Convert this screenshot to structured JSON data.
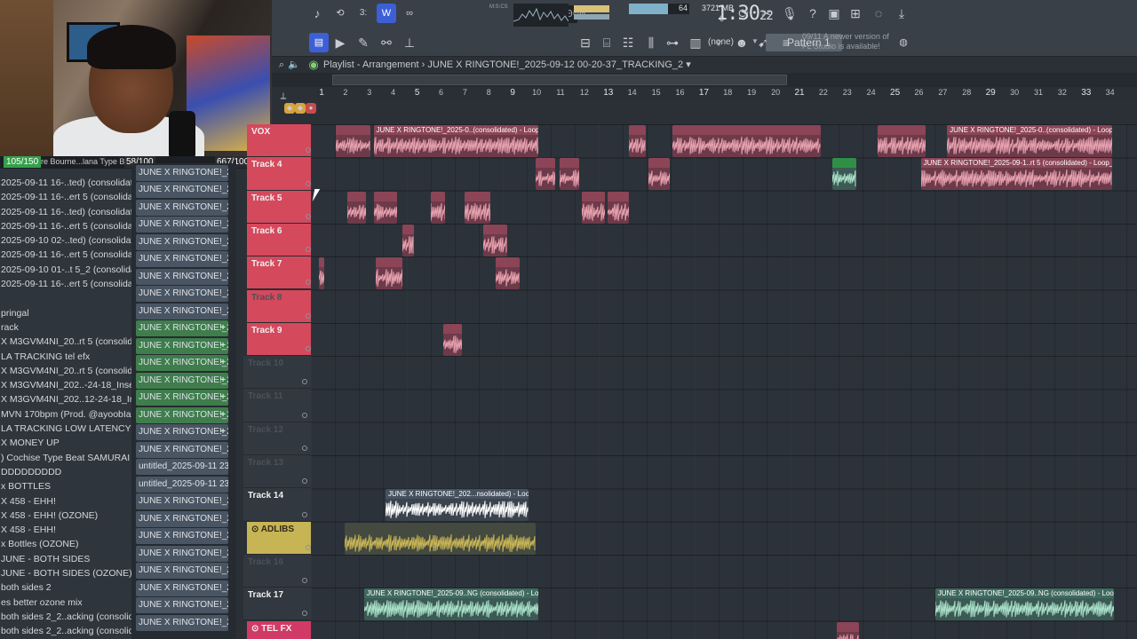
{
  "webcam": {
    "live_badge": "105/150",
    "viewer_count": "58/100",
    "stream_stat": "667/1000",
    "overlay_text": "Pierre Bourne...lana Type Beat Prod"
  },
  "browser": {
    "items": [
      "2025-09-11 16-..ted) (consolidated)",
      "2025-09-11 16-..ert 5 (consolidated)",
      "2025-09-11 16-..ted) (consolidated)",
      "2025-09-11 16-..ert 5 (consolidated)",
      "2025-09-10 02-..ted) (consolidated)",
      "2025-09-11 16-..ert 5 (consolidated)",
      "2025-09-10 01-..t 5_2 (consolidated)",
      "2025-09-11 16-..ert 5 (consolidated)",
      "",
      "pringal",
      "rack",
      "X M3GVM4NI_20..rt 5 (consolidated)",
      "LA TRACKING tel efx",
      "X M3GVM4NI_20..rt 5 (consolidated)",
      "X M3GVM4NI_202..-24-18_Insert 5_2",
      "X M3GVM4NI_202..12-24-18_Insert 5",
      "MVN 170bpm (Prod. @ayoobIanco_)",
      "LA TRACKING LOW LATENCY",
      "X MONEY UP",
      ") Cochise Type Beat SAMURAI",
      "DDDDDDDDD",
      "x BOTTLES",
      "X 458 - EHH!",
      "X 458 - EHH! (OZONE)",
      "X 458 - EHH!",
      "x Bottles (OZONE)",
      "JUNE - BOTH SIDES",
      "JUNE - BOTH SIDES (OZONE)",
      "both sides 2",
      "es better ozone mix",
      "both sides 2_2..acking (consolidated)",
      "both sides 2_2..acking (consolidated)"
    ]
  },
  "picker": {
    "items": [
      {
        "label": "JUNE X RINGTONE!_2025-...",
        "style": "gray"
      },
      {
        "label": "JUNE X RINGTONE!_2025-...",
        "style": "gray"
      },
      {
        "label": "JUNE X RINGTONE!_2025-...",
        "style": "gray"
      },
      {
        "label": "JUNE X RINGTONE!_2025-...",
        "style": "gray"
      },
      {
        "label": "JUNE X RINGTONE!_2025-...",
        "style": "gray"
      },
      {
        "label": "JUNE X RINGTONE!_2025-...",
        "style": "gray"
      },
      {
        "label": "JUNE X RINGTONE!_2025-...",
        "style": "gray"
      },
      {
        "label": "JUNE X RINGTONE!_2025-...",
        "style": "gray"
      },
      {
        "label": "JUNE X RINGTONE!_2025-...",
        "style": "gray"
      },
      {
        "label": "JUNE X RINGTONE!_2...",
        "style": "green"
      },
      {
        "label": "JUNE X RINGTONE!_2...",
        "style": "green"
      },
      {
        "label": "JUNE X RINGTONE!_2...",
        "style": "green"
      },
      {
        "label": "JUNE X RINGTONE!_2...",
        "style": "green"
      },
      {
        "label": "JUNE X RINGTONE!_2...",
        "style": "green"
      },
      {
        "label": "JUNE X RINGTONE!_2...",
        "style": "green"
      },
      {
        "label": "JUNE X RINGTONE!_2...",
        "style": "gray-plus"
      },
      {
        "label": "JUNE X RINGTONE!_2025-...",
        "style": "gray"
      },
      {
        "label": "untitled_2025-09-11 23-...",
        "style": "gray"
      },
      {
        "label": "untitled_2025-09-11 23-...",
        "style": "gray"
      },
      {
        "label": "JUNE X RINGTONE!_2025-...",
        "style": "gray"
      },
      {
        "label": "JUNE X RINGTONE!_2025-...",
        "style": "gray"
      },
      {
        "label": "JUNE X RINGTONE!_2025-...",
        "style": "gray"
      },
      {
        "label": "JUNE X RINGTONE!_2025-...",
        "style": "gray"
      },
      {
        "label": "JUNE X RINGTONE!_2025-...",
        "style": "gray"
      },
      {
        "label": "JUNE X RINGTONE!_2025-...",
        "style": "gray"
      },
      {
        "label": "JUNE X RINGTONE!_2025-...",
        "style": "gray"
      },
      {
        "label": "JUNE X RINGTONE!_2025-...",
        "style": "gray"
      }
    ]
  },
  "toolbar": {
    "tempo": "97.000",
    "time": "1:30",
    "time_frac": "22",
    "time_unit": "M:S:CS",
    "cpu": "64",
    "cpu_fraction": 0.64,
    "memory": "3721 MB",
    "memory_sub": "0",
    "snap": "(none)",
    "pattern": "Pattern 1",
    "news_date": "09/11",
    "news_text": "A newer version of FL Studio is available!"
  },
  "playlist": {
    "title": "Playlist - Arrangement",
    "arrangement": "JUNE X RINGTONE!_2025-09-12 00-20-37_TRACKING_2",
    "bar_numbers": [
      "1",
      "2",
      "3",
      "4",
      "5",
      "6",
      "7",
      "8",
      "9",
      "10",
      "11",
      "12",
      "13",
      "14",
      "15",
      "16",
      "17",
      "18",
      "19",
      "20",
      "21",
      "22",
      "23",
      "24",
      "25",
      "26",
      "27",
      "28",
      "29",
      "30",
      "31",
      "32",
      "33",
      "34"
    ],
    "tracks": [
      {
        "name": "VOX",
        "style": "red"
      },
      {
        "name": "Track 4",
        "style": "red"
      },
      {
        "name": "Track 5",
        "style": "red"
      },
      {
        "name": "Track 6",
        "style": "red"
      },
      {
        "name": "Track 7",
        "style": "red"
      },
      {
        "name": "Track 8",
        "style": "red-dim"
      },
      {
        "name": "Track 9",
        "style": "red"
      },
      {
        "name": "Track 10",
        "style": "dim"
      },
      {
        "name": "Track 11",
        "style": "dim"
      },
      {
        "name": "Track 12",
        "style": "dim"
      },
      {
        "name": "Track 13",
        "style": "dim"
      },
      {
        "name": "Track 14",
        "style": "plain"
      },
      {
        "name": "ADLIBS",
        "style": "yellow"
      },
      {
        "name": "Track 16",
        "style": "dim"
      },
      {
        "name": "Track 17",
        "style": "plain"
      },
      {
        "name": "TEL FX",
        "style": "pink"
      }
    ],
    "clips": [
      {
        "track": 0,
        "bar": 1.8,
        "len": 0.9,
        "label": "",
        "style": "red"
      },
      {
        "track": 0,
        "bar": 2.35,
        "len": 0.9,
        "label": "",
        "style": "red"
      },
      {
        "track": 0,
        "bar": 3.4,
        "len": 6.9,
        "label": "JUNE X RINGTONE!_2025-0..(consolidated) - Loop_2",
        "style": "red"
      },
      {
        "track": 0,
        "bar": 14.1,
        "len": 0.7,
        "label": "",
        "style": "red"
      },
      {
        "track": 0,
        "bar": 15.9,
        "len": 6.2,
        "label": "",
        "style": "red"
      },
      {
        "track": 0,
        "bar": 24.5,
        "len": 2.0,
        "label": "",
        "style": "red"
      },
      {
        "track": 0,
        "bar": 27.4,
        "len": 6.9,
        "label": "JUNE X RINGTONE!_2025-0..(consolidated) - Loop_2",
        "style": "red"
      },
      {
        "track": 1,
        "bar": 10.2,
        "len": 0.8,
        "label": "",
        "style": "red"
      },
      {
        "track": 1,
        "bar": 11.2,
        "len": 0.8,
        "label": "",
        "style": "red"
      },
      {
        "track": 1,
        "bar": 14.9,
        "len": 0.9,
        "label": "",
        "style": "red"
      },
      {
        "track": 1,
        "bar": 22.6,
        "len": 1.0,
        "label": "",
        "style": "green solid"
      },
      {
        "track": 1,
        "bar": 26.3,
        "len": 8.0,
        "label": "JUNE X RINGTONE!_2025-09-1..rt 5 (consolidated) - Loop_3",
        "style": "red"
      },
      {
        "track": 2,
        "bar": 2.3,
        "len": 0.8,
        "label": "",
        "style": "red"
      },
      {
        "track": 2,
        "bar": 3.4,
        "len": 1.0,
        "label": "",
        "style": "red"
      },
      {
        "track": 2,
        "bar": 5.8,
        "len": 0.6,
        "label": "",
        "style": "red"
      },
      {
        "track": 2,
        "bar": 7.2,
        "len": 1.1,
        "label": "",
        "style": "red"
      },
      {
        "track": 2,
        "bar": 12.1,
        "len": 1.0,
        "label": "",
        "style": "red"
      },
      {
        "track": 2,
        "bar": 13.2,
        "len": 0.9,
        "label": "",
        "style": "red"
      },
      {
        "track": 3,
        "bar": 4.6,
        "len": 0.5,
        "label": "",
        "style": "red"
      },
      {
        "track": 3,
        "bar": 8.0,
        "len": 1.0,
        "label": "",
        "style": "red"
      },
      {
        "track": 4,
        "bar": 1.1,
        "len": 0.2,
        "label": "",
        "style": "red"
      },
      {
        "track": 4,
        "bar": 3.5,
        "len": 1.1,
        "label": "",
        "style": "red"
      },
      {
        "track": 4,
        "bar": 8.5,
        "len": 1.0,
        "label": "",
        "style": "red"
      },
      {
        "track": 6,
        "bar": 6.3,
        "len": 0.8,
        "label": "",
        "style": "red"
      },
      {
        "track": 11,
        "bar": 3.9,
        "len": 6.0,
        "label": "JUNE X RINGTONE!_202...nsolidated) - Loop_2",
        "style": "gray"
      },
      {
        "track": 12,
        "bar": 2.2,
        "len": 8.0,
        "label": "",
        "style": "olive"
      },
      {
        "track": 14,
        "bar": 3.0,
        "len": 7.3,
        "label": "JUNE X RINGTONE!_2025-09..NG (consolidated) - Loop_3",
        "style": "green"
      },
      {
        "track": 14,
        "bar": 26.9,
        "len": 7.5,
        "label": "JUNE X RINGTONE!_2025-09..NG (consolidated) - Loop_3",
        "style": "green"
      },
      {
        "track": 15,
        "bar": 22.8,
        "len": 0.9,
        "label": "",
        "style": "red"
      }
    ]
  },
  "colors": {
    "accent": "#3d5fd6",
    "track_red": "#d5495d",
    "track_yellow": "#c7b455",
    "track_pink": "#d23a66",
    "clip_green": "#3f6a5f"
  }
}
